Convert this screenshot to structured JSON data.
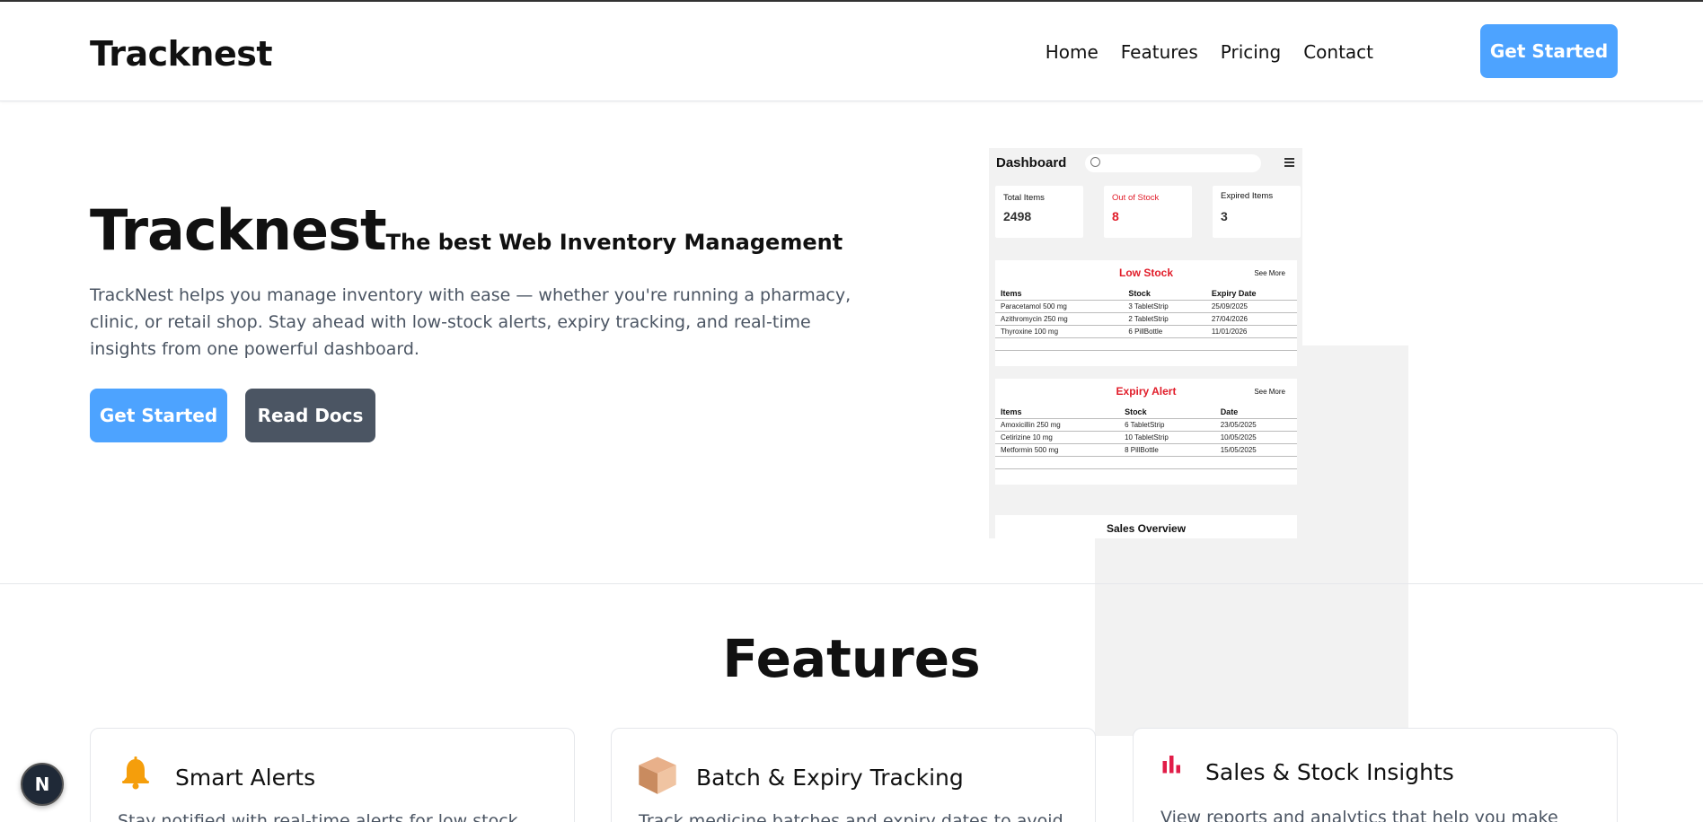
{
  "nav": {
    "brand": "Tracknest",
    "links": [
      "Home",
      "Features",
      "Pricing",
      "Contact"
    ],
    "cta": "Get Started"
  },
  "hero": {
    "title": "Tracknest",
    "dash": "-",
    "subtitle": "The best Web Inventory Management",
    "description": "TrackNest helps you manage inventory with ease — whether you're running a pharmacy, clinic, or retail shop. Stay ahead with low-stock alerts, expiry tracking, and real-time insights from one powerful dashboard.",
    "primary_button": "Get Started",
    "secondary_button": "Read Docs"
  },
  "dashboard": {
    "title": "Dashboard",
    "stats": [
      {
        "label": "Total Items",
        "value": "2498"
      },
      {
        "label": "Out of Stock",
        "value": "8"
      },
      {
        "label": "Expired Items",
        "value": "3"
      }
    ],
    "low_stock": {
      "title": "Low Stock",
      "see_more": "See More",
      "headers": [
        "Items",
        "Stock",
        "Expiry Date"
      ],
      "rows": [
        [
          "Paracetamol 500 mg",
          "3 TabletStrip",
          "25/09/2025"
        ],
        [
          "Azithromycin 250 mg",
          "2 TabletStrip",
          "27/04/2026"
        ],
        [
          "Thyroxine 100 mg",
          "6 PillBottle",
          "11/01/2026"
        ]
      ]
    },
    "expiry_alert": {
      "title": "Expiry Alert",
      "see_more": "See More",
      "headers": [
        "Items",
        "Stock",
        "Date"
      ],
      "rows": [
        [
          "Amoxicillin 250 mg",
          "6 TabletStrip",
          "23/05/2025"
        ],
        [
          "Cetirizine 10 mg",
          "10 TabletStrip",
          "10/05/2025"
        ],
        [
          "Metformin 500 mg",
          "8 PillBottle",
          "15/05/2025"
        ]
      ]
    },
    "sales_title": "Sales Overview"
  },
  "features": {
    "title": "Features",
    "cards": [
      {
        "icon": "bell-icon",
        "title": "Smart Alerts",
        "desc": "Stay notified with real-time alerts for low stock"
      },
      {
        "icon": "box-icon",
        "title": "Batch & Expiry Tracking",
        "desc": "Track medicine batches and expiry dates to avoid"
      },
      {
        "icon": "bar-chart-icon",
        "title": "Sales & Stock Insights",
        "desc": "View reports and analytics that help you make"
      }
    ]
  },
  "badge": "N",
  "colors": {
    "accent": "#4da3ff",
    "dark_button": "#4b5563",
    "alert_red": "#e11d2a"
  }
}
